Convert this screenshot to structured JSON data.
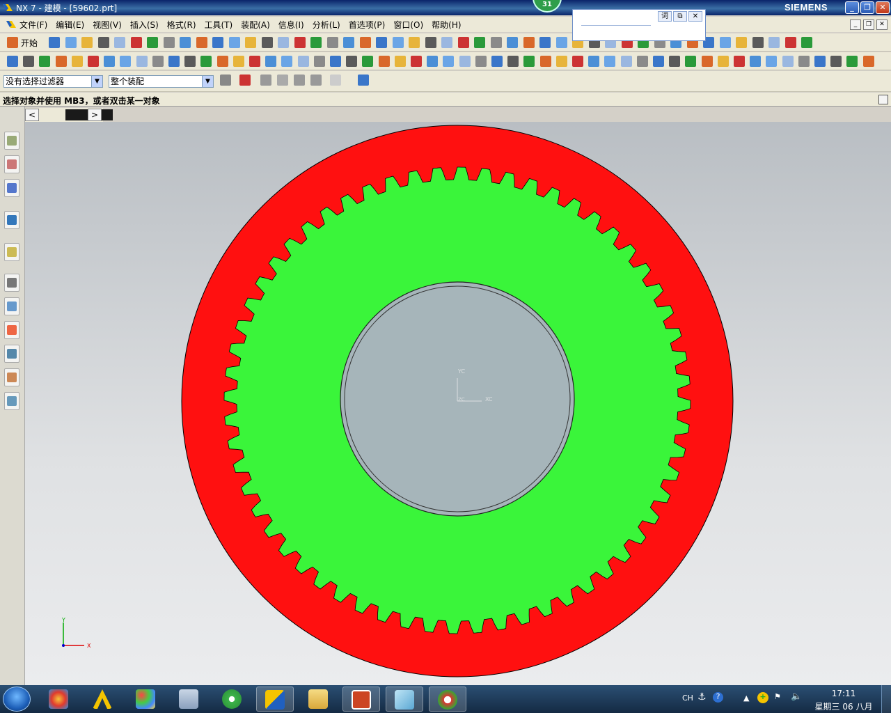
{
  "window": {
    "title": "NX 7 - 建模 - [59602.prt]",
    "brand": "SIEMENS",
    "badge": "31"
  },
  "popup": {
    "btn1": "词",
    "btn2": "⧉",
    "btn3": "✕"
  },
  "menu": {
    "items": [
      "文件(F)",
      "编辑(E)",
      "视图(V)",
      "插入(S)",
      "格式(R)",
      "工具(T)",
      "装配(A)",
      "信息(I)",
      "分析(L)",
      "首选项(P)",
      "窗口(O)",
      "帮助(H)"
    ]
  },
  "toolbar": {
    "start_label": "开始"
  },
  "filter": {
    "selection_filter": "没有选择过滤器",
    "scope": "整个装配"
  },
  "cue": "选择对象并使用 MB3，或者双击某一对象",
  "viewport": {
    "wcs": {
      "x_label": "XC",
      "y_label": "YC",
      "z_label": "ZC"
    },
    "triad": {
      "x_label": "X",
      "y_label": "Y"
    },
    "colors": {
      "outer_ring": "#ff1010",
      "gear": "#3af53a",
      "bore": "#a6b5ba"
    },
    "tooth_count": 60
  },
  "taskbar": {
    "lang": "CH",
    "time": "17:11",
    "date": "星期三 06 八月"
  }
}
